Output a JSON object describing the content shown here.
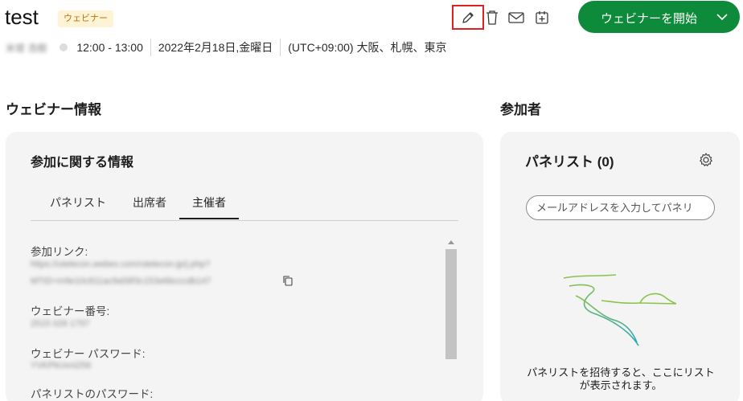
{
  "header": {
    "title": "test",
    "badge": "ウェビナー",
    "start_button": "ウェビナーを開始",
    "host_name": "米堤 浩樹",
    "time": "12:00 - 13:00",
    "date": "2022年2月18日,金曜日",
    "timezone": "(UTC+09:00) 大阪、札幌、東京"
  },
  "webinar_info": {
    "section_title": "ウェビナー情報",
    "card_title": "参加に関する情報",
    "tabs": [
      "パネリスト",
      "出席者",
      "主催者"
    ],
    "active_tab": "主催者",
    "fields": [
      {
        "label": "参加リンク:",
        "value_line1": "https://utelecon.webex.com/utelecon-jp/j.php?",
        "value_line2": "MTID=m9e10c811ac9a58f3c153e6bcccdb147"
      },
      {
        "label": "ウェビナー番号:",
        "value_line1": "2515 028 1797"
      },
      {
        "label": "ウェビナー パスワード:",
        "value_line1": "YVKPkUvni256"
      },
      {
        "label": "パネリストのパスワード:"
      }
    ]
  },
  "participants": {
    "section_title": "参加者",
    "card_title": "パネリスト (0)",
    "email_placeholder": "メールアドレスを入力してパネリ",
    "empty_message": "パネリストを招待すると、ここにリストが表示されます。"
  },
  "colors": {
    "accent_green": "#0d8a3a",
    "badge_bg": "#fff3d6",
    "badge_text": "#b8740a",
    "highlight_red": "#e02020"
  }
}
